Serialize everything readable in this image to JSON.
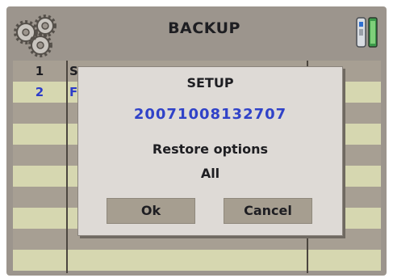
{
  "header": {
    "title": "BACKUP",
    "left_icon": "gears-icon",
    "right_icon": "usb-drive-icon"
  },
  "table": {
    "rows": [
      {
        "num": "1",
        "name": "S"
      },
      {
        "num": "2",
        "name": "F"
      },
      {
        "num": "",
        "name": ""
      },
      {
        "num": "",
        "name": ""
      },
      {
        "num": "",
        "name": ""
      },
      {
        "num": "",
        "name": ""
      },
      {
        "num": "",
        "name": ""
      },
      {
        "num": "",
        "name": ""
      },
      {
        "num": "",
        "name": ""
      },
      {
        "num": "",
        "name": ""
      }
    ]
  },
  "dialog": {
    "title": "SETUP",
    "backup_id": "20071008132707",
    "option_label": "Restore options",
    "option_value": "All",
    "ok_label": "Ok",
    "cancel_label": "Cancel"
  },
  "colors": {
    "screen_bg": "#9c958d",
    "row_light": "#d6d7b0",
    "row_dark": "#a79f93",
    "accent_blue": "#3042c8"
  }
}
